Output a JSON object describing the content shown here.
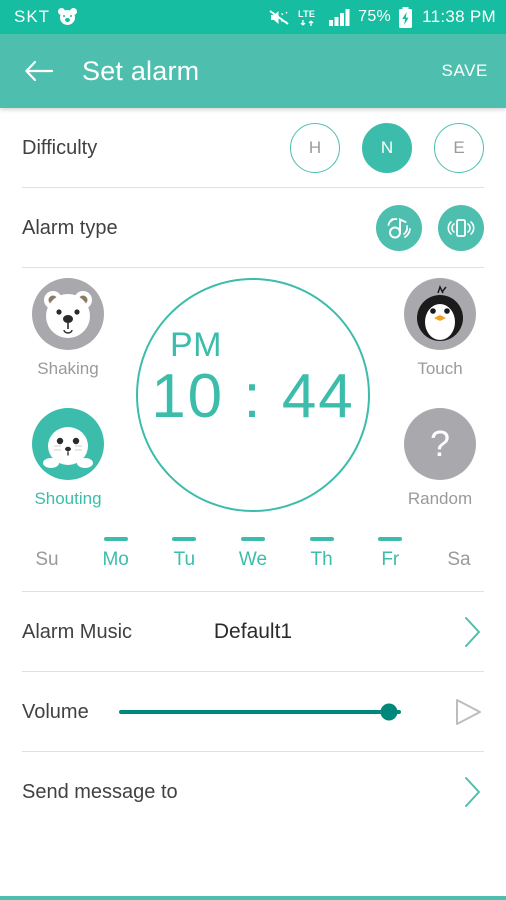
{
  "statusbar": {
    "carrier": "SKT",
    "bear_icon": "bear-alarm-icon",
    "mute_icon": "volume-mute-vibrate-icon",
    "network": "LTE",
    "signal_icon": "signal-bars-icon",
    "battery_percent": "75%",
    "battery_icon": "battery-charging-icon",
    "clock": "11:38 PM",
    "background_color": "#17bda0"
  },
  "appbar": {
    "back_icon": "arrow-left-icon",
    "title": "Set alarm",
    "save_label": "SAVE",
    "background_color": "#4ebfae"
  },
  "difficulty": {
    "label": "Difficulty",
    "options": [
      {
        "label": "H",
        "selected": false
      },
      {
        "label": "N",
        "selected": true
      },
      {
        "label": "E",
        "selected": false
      }
    ]
  },
  "alarm_type": {
    "label": "Alarm type",
    "options": [
      {
        "icon": "sound-note-icon",
        "active": true
      },
      {
        "icon": "vibration-phone-icon",
        "active": true
      }
    ]
  },
  "modes": [
    {
      "label": "Shaking",
      "icon": "polar-bear-icon",
      "active": false
    },
    {
      "label": "Shouting",
      "icon": "seal-icon",
      "active": true
    },
    {
      "label": "Touch",
      "icon": "penguin-icon",
      "active": false
    },
    {
      "label": "Random",
      "icon": "question-mark-icon",
      "active": false
    }
  ],
  "clock": {
    "meridiem": "PM",
    "time": "10 : 44",
    "hour": "10",
    "minute": "44",
    "accent_color": "#3cbcab"
  },
  "days": [
    {
      "label": "Su",
      "selected": false
    },
    {
      "label": "Mo",
      "selected": true
    },
    {
      "label": "Tu",
      "selected": true
    },
    {
      "label": "We",
      "selected": true
    },
    {
      "label": "Th",
      "selected": true
    },
    {
      "label": "Fr",
      "selected": true
    },
    {
      "label": "Sa",
      "selected": false
    }
  ],
  "alarm_music": {
    "label": "Alarm Music",
    "value": "Default1",
    "chevron_icon": "chevron-right-icon"
  },
  "volume": {
    "label": "Volume",
    "value_percent": 96,
    "track_color": "#00897b",
    "play_icon": "play-triangle-icon"
  },
  "send_message": {
    "label": "Send message to",
    "chevron_icon": "chevron-right-icon"
  }
}
